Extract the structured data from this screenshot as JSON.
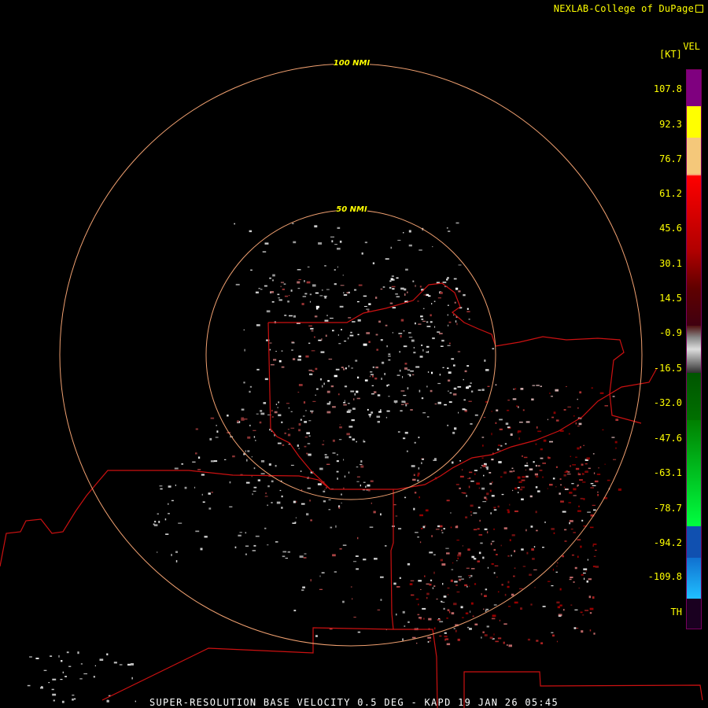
{
  "credit": "NEXLAB-College of DuPage",
  "credit_icon": "external-link-icon",
  "legend": {
    "title": "VEL",
    "unit": "[KT]",
    "labels": [
      "107.8",
      "92.3",
      "76.7",
      "61.2",
      "45.6",
      "30.1",
      "14.5",
      "-0.9",
      "-16.5",
      "-32.0",
      "-47.6",
      "-63.1",
      "-78.7",
      "-94.2",
      "-109.8",
      "TH"
    ]
  },
  "rings": [
    {
      "label": "100 NMI"
    },
    {
      "label": "50 NMI"
    }
  ],
  "colors": {
    "ring": "#f0a070",
    "boundary": "#cc1111",
    "label": "#ffff00"
  },
  "footer": "SUPER-RESOLUTION BASE VELOCITY 0.5 DEG - KAPD 19 JAN 26 05:45"
}
